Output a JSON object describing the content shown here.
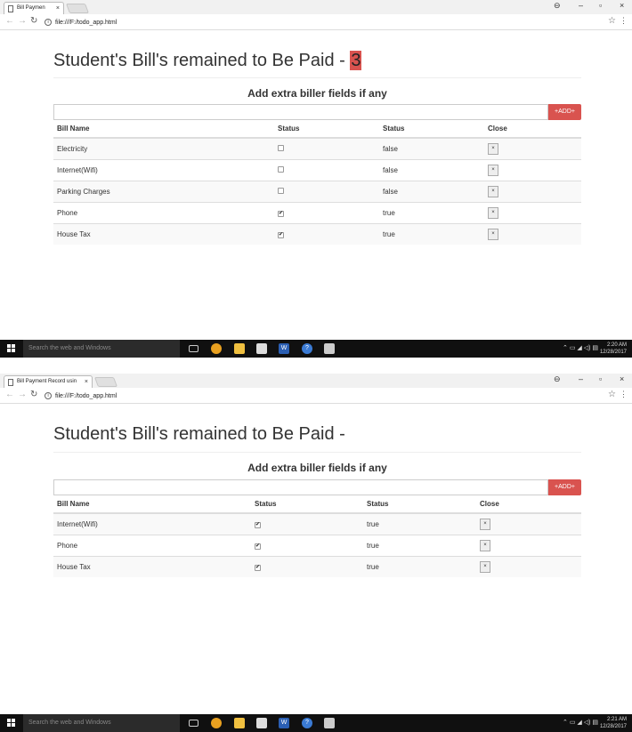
{
  "screens": [
    {
      "tab_title": "Bill Paymen",
      "url": "file:///F:/todo_app.html",
      "heading": "Student's Bill's remained to Be Paid - ",
      "count": "3",
      "subheading": "Add extra biller fields if any",
      "input_value": "",
      "add_label": "+ADD+",
      "columns": [
        "Bill Name",
        "Status",
        "Status",
        "Close"
      ],
      "rows": [
        {
          "name": "Electricity",
          "checked": false,
          "status": "false"
        },
        {
          "name": "Internet(Wifi)",
          "checked": false,
          "status": "false"
        },
        {
          "name": "Parking Charges",
          "checked": false,
          "status": "false"
        },
        {
          "name": "Phone",
          "checked": true,
          "status": "true"
        },
        {
          "name": "House Tax",
          "checked": true,
          "status": "true"
        }
      ],
      "close_label": "×",
      "taskbar_search": "Search the web and Windows",
      "clock_time": "2:20 AM",
      "clock_date": "12/28/2017"
    },
    {
      "tab_title": "Bill Payment Record usin",
      "url": "file:///F:/todo_app.html",
      "heading": "Student's Bill's remained to Be Paid - ",
      "count": "",
      "subheading": "Add extra biller fields if any",
      "input_value": "",
      "add_label": "+ADD+",
      "columns": [
        "Bill Name",
        "Status",
        "Status",
        "Close"
      ],
      "rows": [
        {
          "name": "Internet(Wifi)",
          "checked": true,
          "status": "true"
        },
        {
          "name": "Phone",
          "checked": true,
          "status": "true"
        },
        {
          "name": "House Tax",
          "checked": true,
          "status": "true"
        }
      ],
      "close_label": "×",
      "taskbar_search": "Search the web and Windows",
      "clock_time": "2:21 AM",
      "clock_date": "12/28/2017"
    }
  ],
  "window_controls": {
    "account": "⊖",
    "minimize": "–",
    "restore": "▫",
    "close": "×"
  },
  "colors": {
    "danger": "#d9534f",
    "taskbar": "#101010"
  }
}
